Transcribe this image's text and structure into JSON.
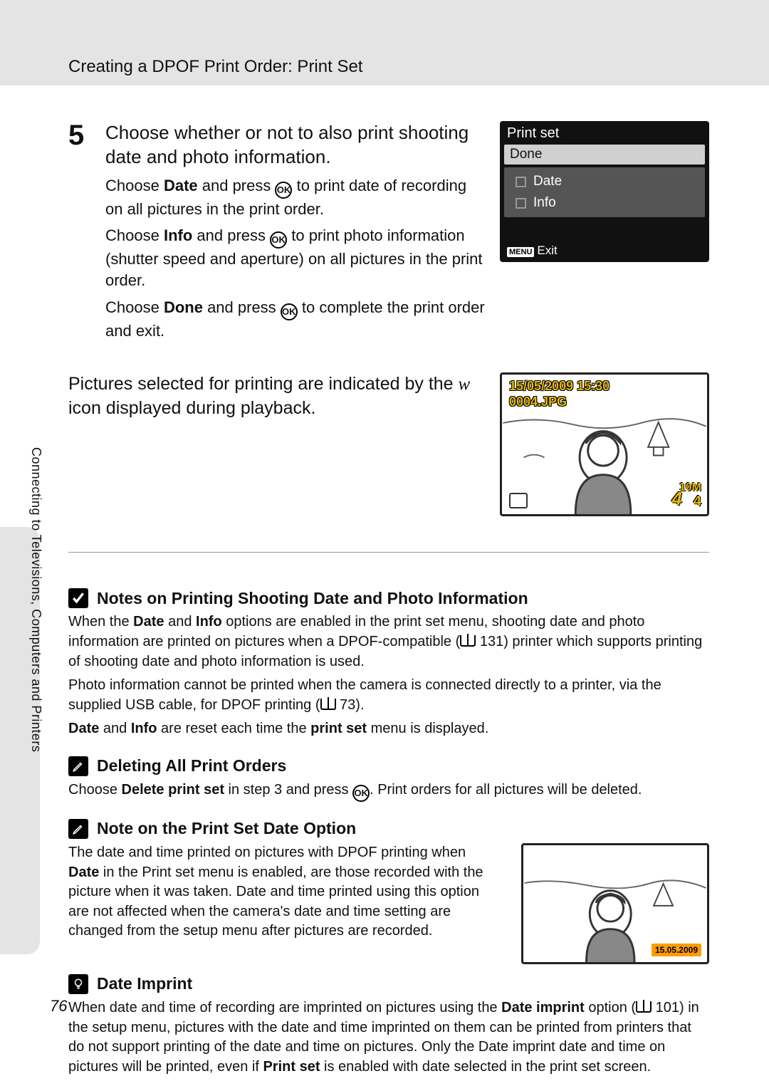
{
  "header": {
    "title": "Creating a DPOF Print Order: Print Set"
  },
  "side_tab": "Connecting to Televisions, Computers and Printers",
  "step": {
    "number": "5",
    "title": "Choose whether or not to also print shooting date and photo information.",
    "p1_a": "Choose ",
    "p1_b": "Date",
    "p1_c": " and press ",
    "p1_d": " to print date of recording on all pictures in the print order.",
    "p2_a": "Choose ",
    "p2_b": "Info",
    "p2_c": " and press ",
    "p2_d": " to print photo information (shutter speed and aperture) on all pictures in the print order.",
    "p3_a": "Choose ",
    "p3_b": "Done",
    "p3_c": " and press ",
    "p3_d": " to complete the print order and exit."
  },
  "ok_label": "OK",
  "lcd": {
    "title": "Print set",
    "done": "Done",
    "date": "Date",
    "info": "Info",
    "menu_label": "MENU",
    "exit": "Exit"
  },
  "row2_a": "Pictures selected for printing are indicated by the ",
  "row2_w": "w",
  "row2_b": " icon displayed during playback.",
  "playback": {
    "timestamp": "15/05/2009 15:30",
    "file": "0004.JPG",
    "num": "4",
    "den_top": "10M",
    "den": "4"
  },
  "notes1": {
    "title": "Notes on Printing Shooting Date and Photo Information",
    "p1_a": "When the ",
    "p1_b": "Date",
    "p1_c": " and ",
    "p1_d": "Info",
    "p1_e": " options are enabled in the print set menu, shooting date and photo information are printed on pictures when a DPOF-compatible (",
    "p1_ref": " 131) printer which supports printing of shooting date and photo information is used.",
    "p2_a": "Photo information cannot be printed when the camera is connected directly to a printer, via the supplied USB cable, for DPOF printing (",
    "p2_ref": " 73).",
    "p3_a": "Date",
    "p3_b": " and ",
    "p3_c": "Info",
    "p3_d": " are reset each time the ",
    "p3_e": "print set",
    "p3_f": " menu is displayed."
  },
  "notes2": {
    "title": "Deleting All Print Orders",
    "p_a": "Choose ",
    "p_b": "Delete print set",
    "p_c": " in step 3 and press ",
    "p_d": ". Print orders for all pictures will be deleted."
  },
  "notes3": {
    "title": "Note on the Print Set Date Option",
    "p_a": "The date and time printed on pictures with DPOF printing when ",
    "p_b": "Date",
    "p_c": " in the Print set menu is enabled, are those recorded with the picture when it was taken. Date and time printed using this option are not affected when the camera's date and time setting are changed from the setup menu after pictures are recorded."
  },
  "notes4": {
    "title": "Date Imprint",
    "p_a": "When date and time of recording are imprinted on pictures using the ",
    "p_b": "Date imprint",
    "p_c": " option (",
    "p_ref": " 101) in the setup menu, pictures with the date and time imprinted on them can be printed from printers that do not support printing of the date and time on pictures. Only the Date imprint date and time on pictures will be printed, even if ",
    "p_d": "Print set",
    "p_e": " is enabled with date selected in the print set screen."
  },
  "small_img_date": "15.05.2009",
  "page_number": "76"
}
